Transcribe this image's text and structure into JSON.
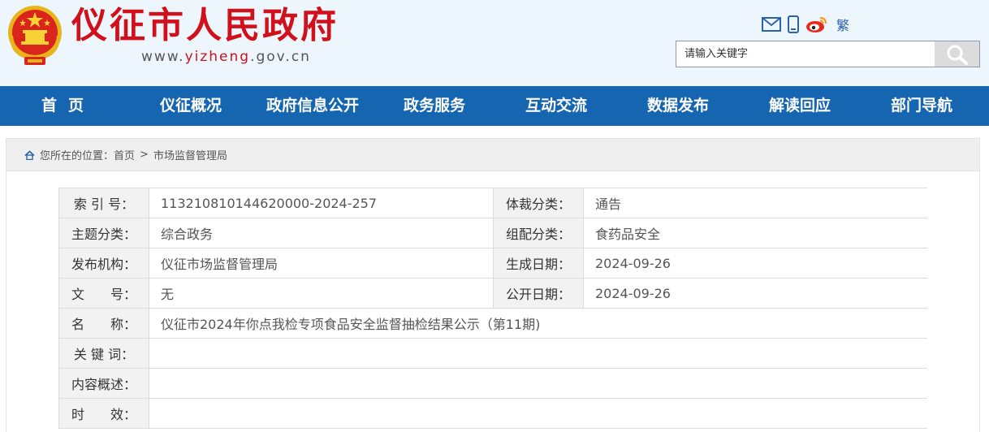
{
  "header": {
    "site_title": "仪征市人民政府",
    "url_prefix": "www.",
    "url_domain": "yizheng",
    "url_suffix": ".gov.cn",
    "traditional_label": "繁",
    "search_placeholder": "请输入关键字"
  },
  "nav": {
    "items": [
      "首页",
      "仪征概况",
      "政府信息公开",
      "政务服务",
      "互动交流",
      "数据发布",
      "解读回应",
      "部门导航"
    ]
  },
  "breadcrumb": {
    "prefix": "您所在的位置：",
    "home": "首页",
    "separator": ">",
    "current": "市场监督管理局"
  },
  "meta": {
    "index_label": "索 引 号：",
    "index_value": "113210810144620000-2024-257",
    "genre_label": "体裁分类：",
    "genre_value": "通告",
    "topic_label": "主题分类：",
    "topic_value": "综合政务",
    "category_label": "组配分类：",
    "category_value": "食药品安全",
    "publisher_label": "发布机构：",
    "publisher_value": "仪征市场监督管理局",
    "created_label": "生成日期：",
    "created_value": "2024-09-26",
    "docno_label": "文　　号：",
    "docno_value": "无",
    "published_label": "公开日期：",
    "published_value": "2024-09-26",
    "name_label": "名　　称：",
    "name_value": "仪征市2024年你点我检专项食品安全监督抽检结果公示（第11期)",
    "keywords_label": "关 键 词：",
    "keywords_value": "",
    "summary_label": "内容概述：",
    "summary_value": "",
    "validity_label": "时　　效：",
    "validity_value": ""
  },
  "colors": {
    "nav_bg": "#1565b0",
    "title_red": "#d0101b",
    "header_bg": "#eef6fd"
  }
}
